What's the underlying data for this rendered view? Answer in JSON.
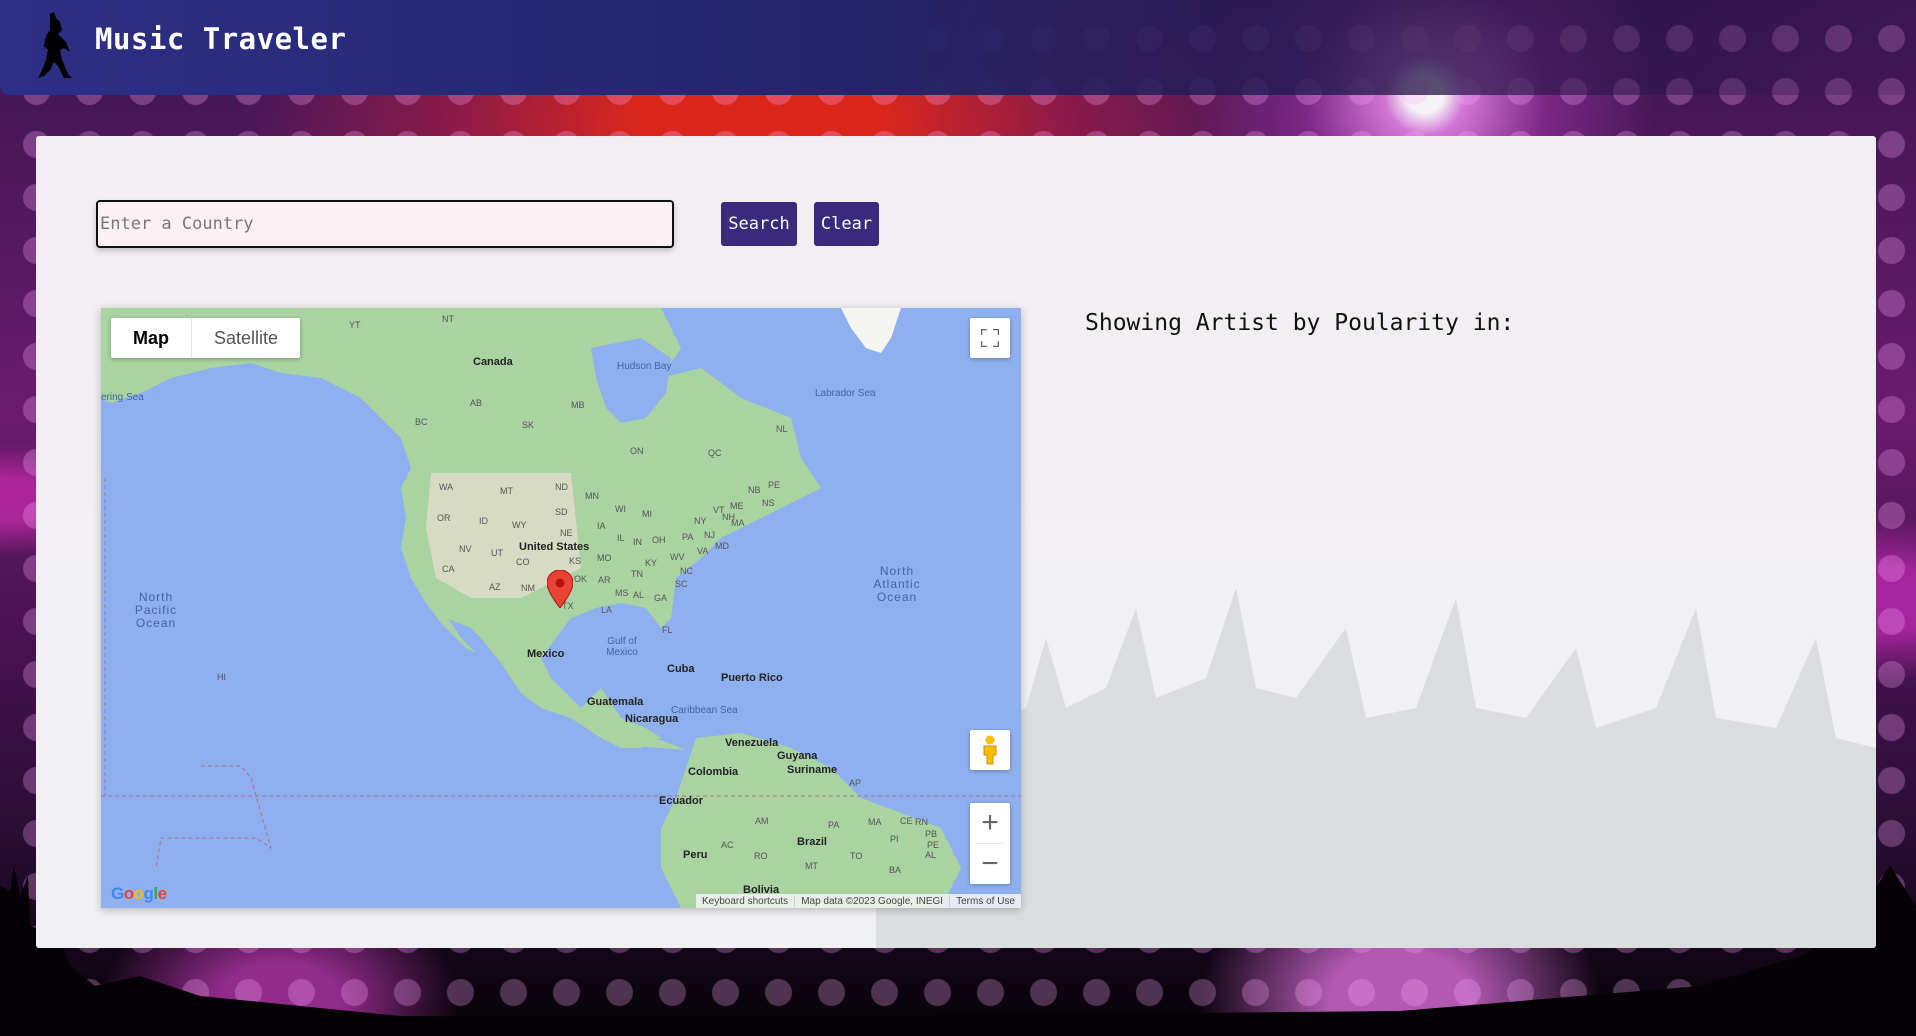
{
  "header": {
    "title": "Music Traveler",
    "logo_icon": "rock-musician-silhouette-icon"
  },
  "search": {
    "placeholder": "Enter a Country",
    "value": "",
    "search_label": "Search",
    "clear_label": "Clear"
  },
  "results": {
    "title": "Showing Artist by Poularity in:"
  },
  "map": {
    "type_tabs": [
      "Map",
      "Satellite"
    ],
    "active_type": "Map",
    "google_logo": "Google",
    "attribution": [
      "Keyboard shortcuts",
      "Map data ©2023 Google, INEGI",
      "Terms of Use"
    ],
    "labels": {
      "countries": [
        "Canada",
        "United States",
        "Mexico",
        "Cuba",
        "Puerto Rico",
        "Guatemala",
        "Nicaragua",
        "Venezuela",
        "Guyana",
        "Suriname",
        "Colombia",
        "Ecuador",
        "Peru",
        "Brazil",
        "Bolivia"
      ],
      "oceans": [
        "North Pacific Ocean",
        "North Atlantic Ocean"
      ],
      "seas": [
        "Hudson Bay",
        "Labrador Sea",
        "Gulf of Mexico",
        "Caribbean Sea",
        "ering Sea"
      ],
      "regions": [
        "YT",
        "NT",
        "AB",
        "BC",
        "SK",
        "MB",
        "ON",
        "QC",
        "NL",
        "NB",
        "PE",
        "NS",
        "WA",
        "MT",
        "ND",
        "MN",
        "OR",
        "ID",
        "WY",
        "SD",
        "WI",
        "MI",
        "NY",
        "ME",
        "VT",
        "NH",
        "NE",
        "IA",
        "IL",
        "IN",
        "OH",
        "PA",
        "NJ",
        "MA",
        "NV",
        "UT",
        "CO",
        "KS",
        "MO",
        "KY",
        "WV",
        "VA",
        "MD",
        "CA",
        "AZ",
        "NM",
        "OK",
        "AR",
        "TN",
        "NC",
        "SC",
        "MS",
        "AL",
        "GA",
        "LA",
        "TX",
        "FL",
        "HI",
        "AM",
        "PA",
        "MA",
        "CE",
        "RN",
        "PB",
        "PE",
        "AL",
        "PI",
        "TO",
        "BA",
        "AC",
        "RO",
        "MT",
        "AP"
      ]
    },
    "marker": {
      "icon": "map-pin-icon",
      "color": "#ea4335"
    },
    "controls": {
      "fullscreen_icon": "fullscreen-icon",
      "pegman_icon": "street-view-pegman-icon",
      "zoom_in": "+",
      "zoom_out": "−"
    }
  },
  "colors": {
    "header_bg": "#2d2f86",
    "button_bg": "#3a2a7e",
    "panel_bg": "#f2eef2",
    "map_water": "#8fb0ee",
    "map_land": "#a9d3a0"
  }
}
